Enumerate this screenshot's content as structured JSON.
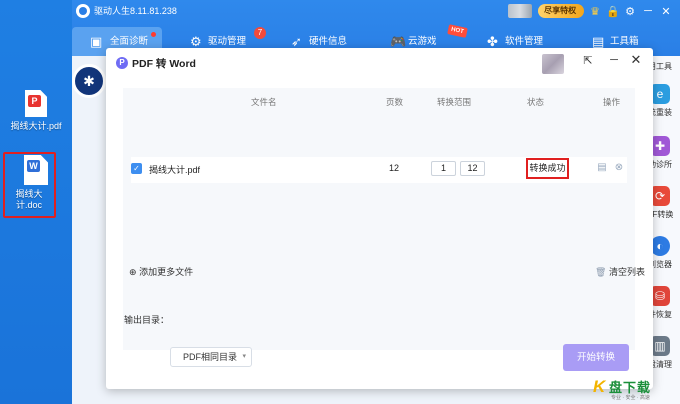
{
  "desktop": {
    "files": [
      {
        "name": "揭线大计.pdf",
        "icon": "pdf-file-icon",
        "badge": "P",
        "color": "#e8332f"
      },
      {
        "name": "揭线大计.doc",
        "icon": "word-file-icon",
        "badge": "W",
        "color": "#2f6fd8"
      }
    ],
    "highlight_color": "#e02020"
  },
  "app": {
    "title": "驱动人生8.11.81.238",
    "vip_label": "尽享特权",
    "nav": [
      {
        "label": "全面诊断",
        "icon": "monitor-icon",
        "active": true
      },
      {
        "label": "驱动管理",
        "icon": "gear-icon",
        "badge": "7"
      },
      {
        "label": "硬件信息",
        "icon": "rocket-icon"
      },
      {
        "label": "云游戏",
        "icon": "gamepad-icon",
        "tag": "HOT"
      },
      {
        "label": "软件管理",
        "icon": "apps-icon"
      },
      {
        "label": "工具箱",
        "icon": "toolbox-icon"
      }
    ],
    "side_tools": [
      {
        "label": "用工具",
        "icon": "tools-icon",
        "color": "#2a7fe6"
      },
      {
        "label": "统重装",
        "icon": "edge-icon",
        "color": "#2b9de0"
      },
      {
        "label": "动诊所",
        "icon": "stethoscope-icon",
        "color": "#a058d6"
      },
      {
        "label": "DF转换",
        "icon": "pdf-convert-icon",
        "color": "#e84a3a"
      },
      {
        "label": "浏览器",
        "icon": "browser-icon",
        "color": "#2d7be3"
      },
      {
        "label": "件恢复",
        "icon": "file-recovery-icon",
        "color": "#e0453a"
      },
      {
        "label": "盘清理",
        "icon": "disk-clean-icon",
        "color": "#6c7a89"
      }
    ]
  },
  "dialog": {
    "title": "PDF 转 Word",
    "columns": {
      "filename": "文件名",
      "pages": "页数",
      "range": "转换范围",
      "status": "状态",
      "action": "操作"
    },
    "rows": [
      {
        "filename": "揭线大计.pdf",
        "pages": "12",
        "range_from": "1",
        "range_to": "12",
        "status": "转换成功"
      }
    ],
    "add_more": "添加更多文件",
    "clear_list": "清空列表",
    "output_label": "输出目录：",
    "output_value": "PDF相同目录",
    "start_button": "开始转换",
    "accent_color": "#a99cf5"
  },
  "watermark": {
    "brand": "盘下载",
    "letter": "K",
    "slogan": "专业 · 安全 · 高速"
  }
}
